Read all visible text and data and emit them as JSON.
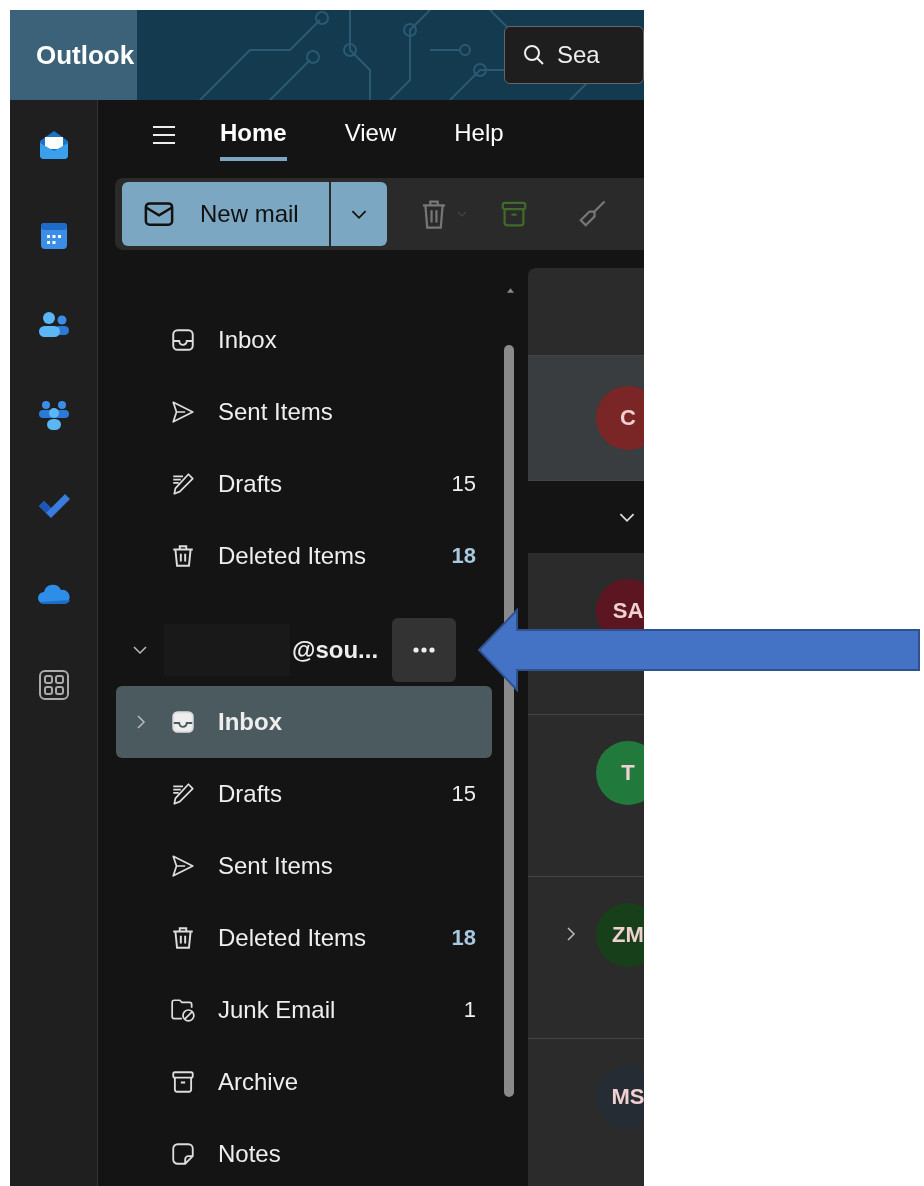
{
  "app": {
    "name": "Outlook"
  },
  "search": {
    "placeholder": "Sea"
  },
  "tabs": [
    {
      "label": "Home",
      "selected": true
    },
    {
      "label": "View",
      "selected": false
    },
    {
      "label": "Help",
      "selected": false
    }
  ],
  "ribbon": {
    "new_mail": "New mail"
  },
  "favorites": [
    {
      "kind": "inbox",
      "label": "Inbox"
    },
    {
      "kind": "sent",
      "label": "Sent Items"
    },
    {
      "kind": "drafts",
      "label": "Drafts",
      "count": "15",
      "unread": false
    },
    {
      "kind": "deleted",
      "label": "Deleted Items",
      "count": "18",
      "unread": true
    }
  ],
  "account": {
    "name": "@sou...",
    "expanded": true,
    "folders": [
      {
        "kind": "inbox",
        "label": "Inbox",
        "selected": true,
        "has_subfolders": true
      },
      {
        "kind": "drafts",
        "label": "Drafts",
        "count": "15",
        "unread": false,
        "selected": false,
        "has_subfolders": false
      },
      {
        "kind": "sent",
        "label": "Sent Items",
        "selected": false,
        "has_subfolders": false
      },
      {
        "kind": "deleted",
        "label": "Deleted Items",
        "count": "18",
        "unread": true,
        "selected": false,
        "has_subfolders": false
      },
      {
        "kind": "junk",
        "label": "Junk Email",
        "count": "1",
        "unread": false,
        "selected": false,
        "has_subfolders": false
      },
      {
        "kind": "archive",
        "label": "Archive",
        "selected": false,
        "has_subfolders": false
      },
      {
        "kind": "notes",
        "label": "Notes",
        "selected": false,
        "has_subfolders": false
      }
    ]
  },
  "messages": [
    {
      "kind": "message",
      "initials": "C",
      "color": "#7a2626",
      "selected": true,
      "thread": false
    },
    {
      "kind": "toggle",
      "selected": false
    },
    {
      "kind": "message",
      "initials": "SA",
      "color": "#5c1622",
      "selected": false,
      "thread": false
    },
    {
      "kind": "message",
      "initials": "T",
      "color": "#217a3c",
      "selected": false,
      "thread": false
    },
    {
      "kind": "message",
      "initials": "ZM",
      "color": "#17401a",
      "selected": false,
      "thread": true
    },
    {
      "kind": "message",
      "initials": "MS",
      "color": "#262c33",
      "selected": false,
      "thread": false
    }
  ]
}
